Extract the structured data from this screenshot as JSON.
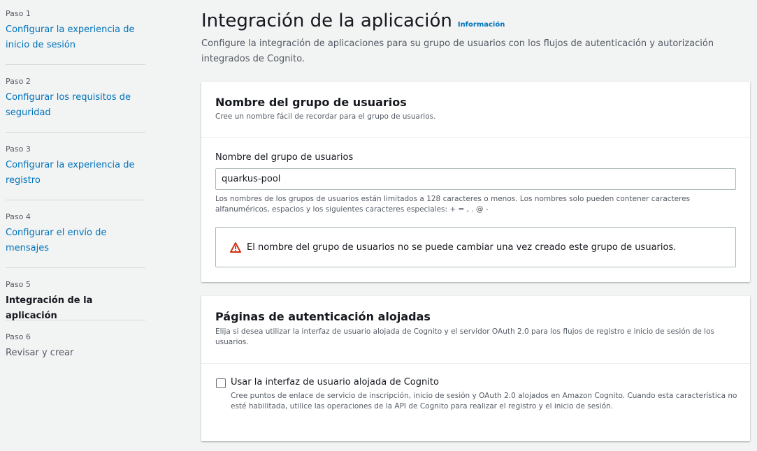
{
  "sidebar": {
    "steps": [
      {
        "num": "Paso 1",
        "label": "Configurar la experiencia de inicio de sesión",
        "state": "link"
      },
      {
        "num": "Paso 2",
        "label": "Configurar los requisitos de seguridad",
        "state": "link"
      },
      {
        "num": "Paso 3",
        "label": "Configurar la experiencia de registro",
        "state": "link"
      },
      {
        "num": "Paso 4",
        "label": "Configurar el envío de mensajes",
        "state": "link"
      },
      {
        "num": "Paso 5",
        "label": "Integración de la aplicación",
        "state": "current"
      },
      {
        "num": "Paso 6",
        "label": "Revisar y crear",
        "state": "pending"
      }
    ]
  },
  "header": {
    "title": "Integración de la aplicación",
    "info_link": "Información",
    "description": "Configure la integración de aplicaciones para su grupo de usuarios con los flujos de autenticación y autorización integrados de Cognito."
  },
  "pool_name_panel": {
    "title": "Nombre del grupo de usuarios",
    "subtitle": "Cree un nombre fácil de recordar para el grupo de usuarios.",
    "field_label": "Nombre del grupo de usuarios",
    "field_value": "quarkus-pool",
    "hint": "Los nombres de los grupos de usuarios están limitados a 128 caracteres o menos. Los nombres solo pueden contener caracteres alfanuméricos, espacios y los siguientes caracteres especiales: + = , . @ -",
    "warning": "El nombre del grupo de usuarios no se puede cambiar una vez creado este grupo de usuarios."
  },
  "hosted_ui_panel": {
    "title": "Páginas de autenticación alojadas",
    "subtitle": "Elija si desea utilizar la interfaz de usuario alojada de Cognito y el servidor OAuth 2.0 para los flujos de registro e inicio de sesión de los usuarios.",
    "checkbox_label": "Usar la interfaz de usuario alojada de Cognito",
    "checkbox_checked": false,
    "checkbox_desc": "Cree puntos de enlace de servicio de inscripción, inicio de sesión y OAuth 2.0 alojados en Amazon Cognito. Cuando esta característica no esté habilitada, utilice las operaciones de la API de Cognito para realizar el registro y el inicio de sesión."
  },
  "colors": {
    "link": "#0073bb",
    "warning": "#d13212",
    "background": "#f2f3f3"
  }
}
